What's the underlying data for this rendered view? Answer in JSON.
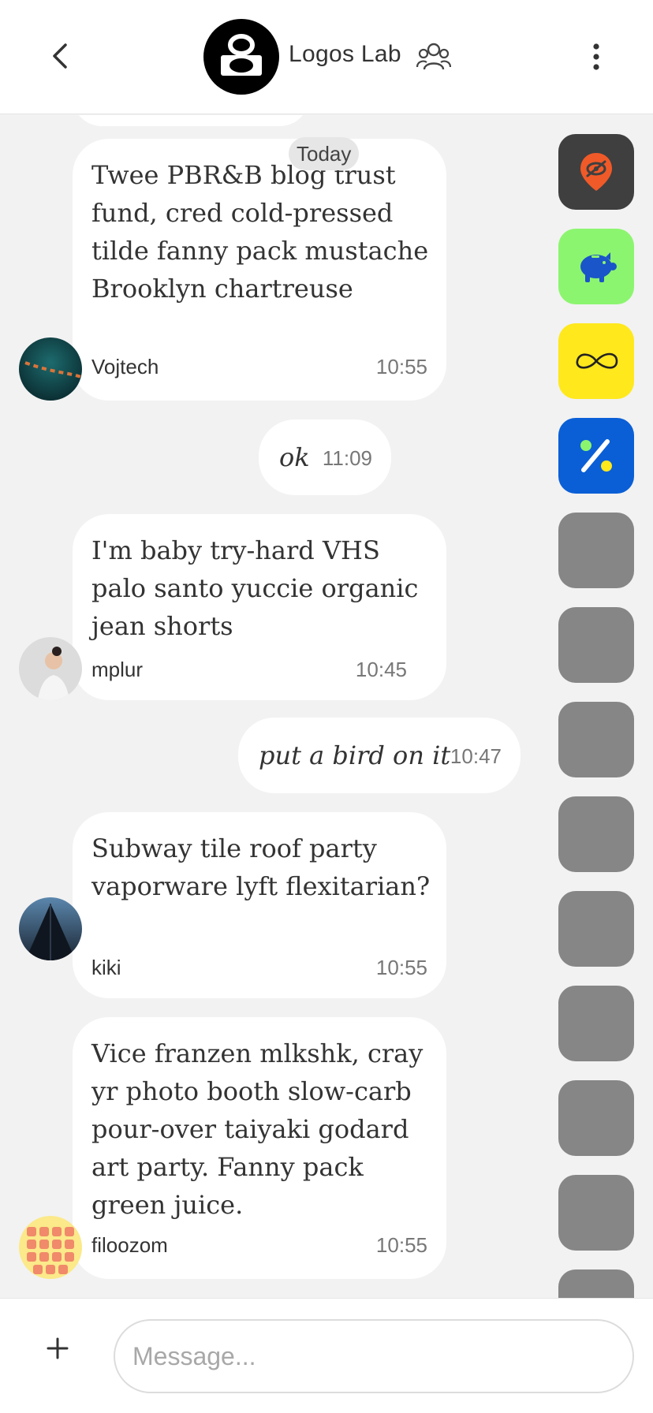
{
  "header": {
    "title": "Logos Lab",
    "back_icon": "chevron-left-icon",
    "group_icon": "people-icon",
    "more_icon": "more-vertical-icon"
  },
  "day_separator": "Today",
  "messages": [
    {
      "type": "incoming",
      "text": "Twee PBR&B blog trust fund, cred cold-pressed tilde fanny pack mustache Brooklyn chartreuse",
      "sender": "Vojtech",
      "time": "10:55"
    },
    {
      "type": "outgoing",
      "text": "ok",
      "time": "11:09"
    },
    {
      "type": "incoming",
      "text": "I'm baby try-hard VHS palo santo yuccie organic jean shorts",
      "sender": "mplur",
      "time": "10:45"
    },
    {
      "type": "outgoing",
      "text": "put a bird on it",
      "time": "10:47"
    },
    {
      "type": "incoming",
      "text": "Subway tile roof party vaporware lyft flexitarian?",
      "sender": "kiki",
      "time": "10:55"
    },
    {
      "type": "incoming",
      "text": "Vice franzen mlkshk, cray yr photo booth slow-carb pour-over taiyaki godard art party. Fanny pack green juice.",
      "sender": "filoozom",
      "time": "10:55"
    }
  ],
  "rail": [
    {
      "icon": "location-hidden-icon",
      "color": "#3f3f3f"
    },
    {
      "icon": "piggy-bank-icon",
      "color": "#8cf56f"
    },
    {
      "icon": "infinity-icon",
      "color": "#ffe81c"
    },
    {
      "icon": "percent-icon",
      "color": "#0a5fd6"
    }
  ],
  "composer": {
    "placeholder": "Message...",
    "add_icon": "plus-icon"
  }
}
